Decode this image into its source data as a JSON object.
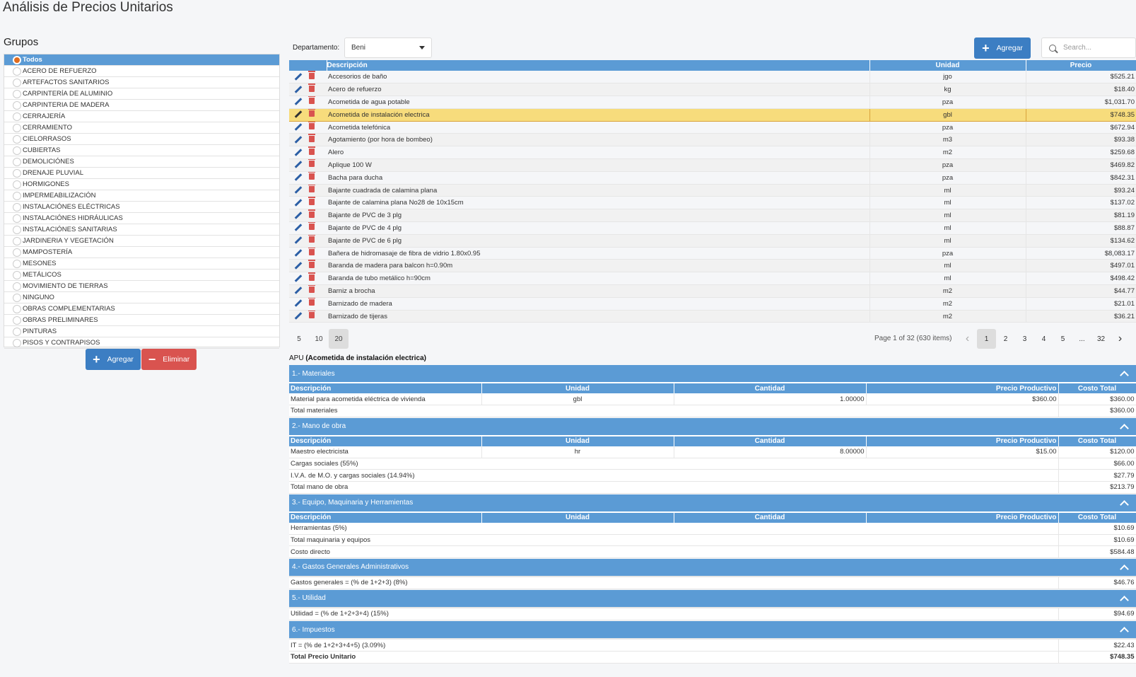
{
  "page_title": "Análisis de Precios Unitarios",
  "groups": {
    "title": "Grupos",
    "items": [
      "Todos",
      "ACERO DE REFUERZO",
      "ARTEFACTOS SANITARIOS",
      "CARPINTERÍA DE ALUMINIO",
      "CARPINTERIA DE MADERA",
      "CERRAJERÍA",
      "CERRAMIENTO",
      "CIELORRASOS",
      "CUBIERTAS",
      "DEMOLICIÓNES",
      "DRENAJE PLUVIAL",
      "HORMIGONES",
      "IMPERMEABILIZACIÓN",
      "INSTALACIÓNES ELÉCTRICAS",
      "INSTALACIÓNES HIDRÁULICAS",
      "INSTALACIÓNES SANITARIAS",
      "JARDINERIA Y VEGETACIÓN",
      "MAMPOSTERÍA",
      "MESONES",
      "METÁLICOS",
      "MOVIMIENTO DE TIERRAS",
      "NINGUNO",
      "OBRAS COMPLEMENTARIAS",
      "OBRAS PRELIMINARES",
      "PINTURAS",
      "PISOS Y CONTRAPISOS"
    ],
    "selected_index": 0,
    "add_label": "Agregar",
    "delete_label": "Eliminar"
  },
  "toolbar": {
    "department_label": "Departamento:",
    "department_value": "Beni",
    "add_label": "Agregar",
    "search_placeholder": "Search..."
  },
  "table": {
    "headers": [
      "Descripción",
      "Unidad",
      "Precio"
    ],
    "selected_index": 3,
    "rows": [
      [
        "Accesorios de baño",
        "jgo",
        "$525.21"
      ],
      [
        "Acero de refuerzo",
        "kg",
        "$18.40"
      ],
      [
        "Acometida de agua potable",
        "pza",
        "$1,031.70"
      ],
      [
        "Acometida de instalación electrica",
        "gbl",
        "$748.35"
      ],
      [
        "Acometida telefónica",
        "pza",
        "$672.94"
      ],
      [
        "Agotamiento (por hora de bombeo)",
        "m3",
        "$93.38"
      ],
      [
        "Alero",
        "m2",
        "$259.68"
      ],
      [
        "Aplique 100 W",
        "pza",
        "$469.82"
      ],
      [
        "Bacha para ducha",
        "pza",
        "$842.31"
      ],
      [
        "Bajante cuadrada de calamina plana",
        "ml",
        "$93.24"
      ],
      [
        "Bajante de calamina plana No28 de 10x15cm",
        "ml",
        "$137.02"
      ],
      [
        "Bajante de PVC de 3 plg",
        "ml",
        "$81.19"
      ],
      [
        "Bajante de PVC de 4 plg",
        "ml",
        "$88.87"
      ],
      [
        "Bajante de PVC de 6 plg",
        "ml",
        "$134.62"
      ],
      [
        "Bañera de hidromasaje de fibra de vidrio 1.80x0.95",
        "pza",
        "$8,083.17"
      ],
      [
        "Baranda de madera para balcon h=0.90m",
        "ml",
        "$497.01"
      ],
      [
        "Baranda de tubo metálico h=90cm",
        "ml",
        "$498.42"
      ],
      [
        "Barniz a brocha",
        "m2",
        "$44.77"
      ],
      [
        "Barnizado de madera",
        "m2",
        "$21.01"
      ],
      [
        "Barnizado de tijeras",
        "m2",
        "$36.21"
      ]
    ]
  },
  "pager": {
    "page_sizes": [
      "5",
      "10",
      "20"
    ],
    "active_size": "20",
    "info": "Page 1 of 32 (630 items)",
    "pages": [
      "1",
      "2",
      "3",
      "4",
      "5",
      "...",
      "32"
    ],
    "active_page": "1"
  },
  "apu": {
    "prefix": "APU",
    "item": "(Acometida de instalación electrica)",
    "col_headers": [
      "Descripción",
      "Unidad",
      "Cantidad",
      "Precio Productivo",
      "Costo Total"
    ],
    "sections": [
      {
        "title": "1.- Materiales",
        "show_headers": true,
        "rows": [
          [
            "Material para acometida eléctrica de vivienda",
            "gbl",
            "1.00000",
            "$360.00",
            "$360.00"
          ]
        ],
        "summary": [
          [
            "Total materiales",
            "$360.00"
          ]
        ]
      },
      {
        "title": "2.- Mano de obra",
        "show_headers": true,
        "rows": [
          [
            "Maestro electricista",
            "hr",
            "8.00000",
            "$15.00",
            "$120.00"
          ]
        ],
        "summary": [
          [
            "Cargas sociales (55%)",
            "$66.00"
          ],
          [
            "I.V.A. de M.O. y cargas sociales (14.94%)",
            "$27.79"
          ],
          [
            "Total mano de obra",
            "$213.79"
          ]
        ]
      },
      {
        "title": "3.- Equipo, Maquinaria y Herramientas",
        "show_headers": true,
        "rows": [],
        "summary": [
          [
            "Herramientas (5%)",
            "$10.69"
          ],
          [
            "Total maquinaria y equipos",
            "$10.69"
          ],
          [
            "Costo directo",
            "$584.48"
          ]
        ]
      },
      {
        "title": "4.- Gastos Generales Administrativos",
        "show_headers": false,
        "rows": [],
        "summary": [
          [
            "Gastos generales = (% de 1+2+3) (8%)",
            "$46.76"
          ]
        ]
      },
      {
        "title": "5.- Utilidad",
        "show_headers": false,
        "rows": [],
        "summary": [
          [
            "Utilidad = (% de 1+2+3+4) (15%)",
            "$94.69"
          ]
        ]
      },
      {
        "title": "6.- Impuestos",
        "show_headers": false,
        "rows": [],
        "summary": [
          [
            "IT = (% de 1+2+3+4+5) (3.09%)",
            "$22.43"
          ]
        ]
      }
    ],
    "grand_total_label": "Total Precio Unitario",
    "grand_total_value": "$748.35"
  },
  "colors": {
    "header_blue": "#5b9bd5",
    "selected_row": "#f7dc7c",
    "accent_orange": "#e06c1f",
    "delete_red": "#d9534f"
  }
}
